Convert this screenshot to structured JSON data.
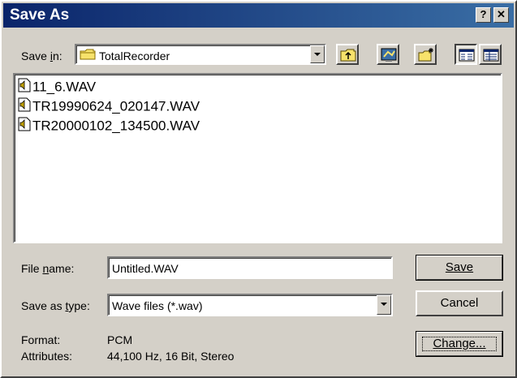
{
  "window": {
    "title": "Save As",
    "help_label": "?",
    "close_label": "✕"
  },
  "toolbar": {
    "save_in_label": "Save in:",
    "save_in_value": "TotalRecorder",
    "buttons": [
      "up-one-level",
      "desktop",
      "create-new-folder",
      "list-view",
      "details-view"
    ]
  },
  "files": [
    {
      "name": "11_6.WAV"
    },
    {
      "name": "TR19990624_020147.WAV"
    },
    {
      "name": "TR20000102_134500.WAV"
    }
  ],
  "form": {
    "file_name_label": "File name:",
    "file_name_value": "Untitled.WAV",
    "save_type_label": "Save as type:",
    "save_type_value": "Wave files (*.wav)"
  },
  "buttons": {
    "save": "Save",
    "cancel": "Cancel",
    "change": "Change..."
  },
  "info": {
    "format_label": "Format:",
    "format_value": "PCM",
    "attributes_label": "Attributes:",
    "attributes_value": "44,100 Hz, 16 Bit, Stereo"
  },
  "colors": {
    "title_bar_start": "#0a246a",
    "title_bar_end": "#3a6ea5",
    "dialog_face": "#d4d0c8",
    "folder_yellow": "#f7e26b"
  }
}
